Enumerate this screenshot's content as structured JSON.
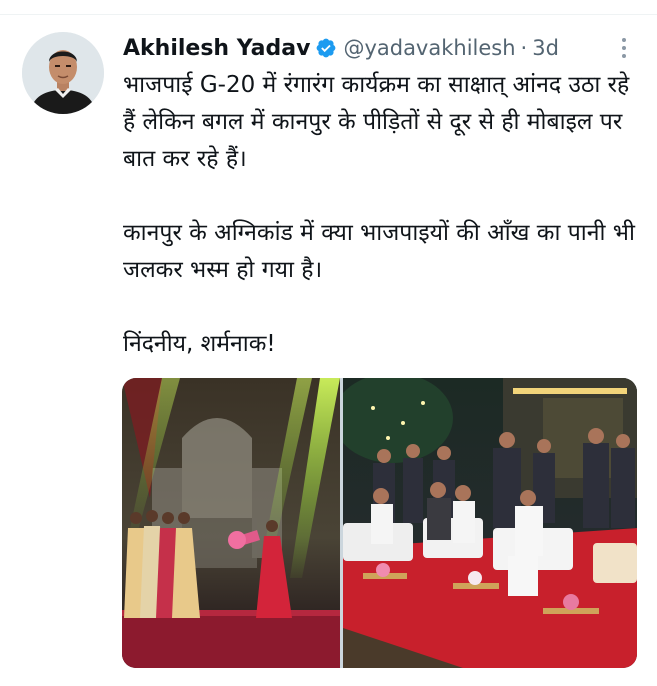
{
  "tweet": {
    "author": {
      "name": "Akhilesh Yadav",
      "handle": "@yadavakhilesh",
      "verified_icon": "verified-badge-icon",
      "avatar": "profile-photo"
    },
    "separator": "·",
    "timestamp": "3d",
    "more_icon": "more-options-icon",
    "text": "भाजपाई G-20 में रंगारंग कार्यक्रम का साक्षात् आंनद उठा रहे हैं लेकिन बगल में कानपुर के पीड़ितों से दूर से ही मोबाइल पर बात कर रहे हैं।\n\nकानपुर के अग्निकांड में क्या भाजपाइयों की आँख का पानी भी जलकर भस्म हो गया है।\n\nनिंदनीय, शर्मनाक!",
    "media": [
      {
        "kind": "photo",
        "subject": "stage-dance-performance"
      },
      {
        "kind": "photo",
        "subject": "seated-dignitaries-red-carpet"
      }
    ]
  },
  "colors": {
    "verified": "#1d9bf0",
    "secondary_text": "#536471",
    "primary_text": "#0f1419"
  }
}
